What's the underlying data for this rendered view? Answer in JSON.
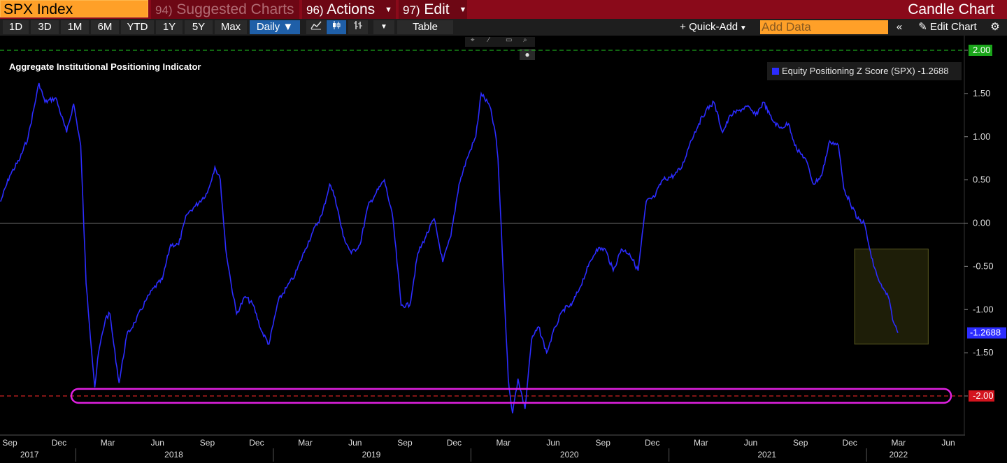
{
  "header": {
    "ticker": "SPX Index",
    "suggested": {
      "num": "94)",
      "label": "Suggested Charts"
    },
    "actions": {
      "num": "96)",
      "label": "Actions"
    },
    "edit": {
      "num": "97)",
      "label": "Edit"
    },
    "chart_type": "Candle Chart"
  },
  "toolbar": {
    "ranges": [
      "1D",
      "3D",
      "1M",
      "6M",
      "YTD",
      "1Y",
      "5Y",
      "Max"
    ],
    "interval": "Daily",
    "table_label": "Table",
    "quick_add": "Quick-Add",
    "add_data_placeholder": "Add Data",
    "edit_chart": "Edit Chart"
  },
  "colors": {
    "series": "#2c2cff",
    "upper_band": "#22cc22",
    "lower_band": "#ff2a2a",
    "highlight_ring": "#e020e0",
    "highlight_box": "#5a5a20"
  },
  "chart_data": {
    "type": "line",
    "title": "Aggregate Institutional Positioning Indicator",
    "series": [
      {
        "name": "Equity Positioning Z Score (SPX)",
        "last_value": "-1.2688",
        "points": [
          [
            "2017-08-15",
            0.25
          ],
          [
            "2017-09-01",
            0.55
          ],
          [
            "2017-09-20",
            0.75
          ],
          [
            "2017-10-05",
            1.0
          ],
          [
            "2017-10-25",
            1.62
          ],
          [
            "2017-11-05",
            1.4
          ],
          [
            "2017-11-25",
            1.45
          ],
          [
            "2017-12-15",
            1.05
          ],
          [
            "2017-12-28",
            1.38
          ],
          [
            "2018-01-10",
            0.9
          ],
          [
            "2018-01-20",
            -0.7
          ],
          [
            "2018-02-05",
            -1.9
          ],
          [
            "2018-02-12",
            -1.5
          ],
          [
            "2018-02-25",
            -1.1
          ],
          [
            "2018-03-05",
            -1.05
          ],
          [
            "2018-03-12",
            -1.4
          ],
          [
            "2018-03-22",
            -1.85
          ],
          [
            "2018-04-05",
            -1.3
          ],
          [
            "2018-04-20",
            -1.15
          ],
          [
            "2018-05-10",
            -0.9
          ],
          [
            "2018-05-25",
            -0.75
          ],
          [
            "2018-06-10",
            -0.65
          ],
          [
            "2018-06-25",
            -0.25
          ],
          [
            "2018-07-10",
            -0.25
          ],
          [
            "2018-07-25",
            0.1
          ],
          [
            "2018-08-10",
            0.2
          ],
          [
            "2018-09-01",
            0.35
          ],
          [
            "2018-09-15",
            0.65
          ],
          [
            "2018-09-25",
            0.5
          ],
          [
            "2018-10-05",
            -0.3
          ],
          [
            "2018-10-15",
            -0.7
          ],
          [
            "2018-10-25",
            -1.05
          ],
          [
            "2018-11-10",
            -0.85
          ],
          [
            "2018-11-25",
            -0.95
          ],
          [
            "2018-12-10",
            -1.25
          ],
          [
            "2018-12-24",
            -1.4
          ],
          [
            "2019-01-10",
            -0.9
          ],
          [
            "2019-01-25",
            -0.75
          ],
          [
            "2019-02-10",
            -0.6
          ],
          [
            "2019-03-01",
            -0.3
          ],
          [
            "2019-03-15",
            -0.1
          ],
          [
            "2019-04-01",
            0.1
          ],
          [
            "2019-04-15",
            0.45
          ],
          [
            "2019-04-25",
            0.3
          ],
          [
            "2019-05-10",
            -0.15
          ],
          [
            "2019-05-25",
            -0.35
          ],
          [
            "2019-06-10",
            -0.25
          ],
          [
            "2019-06-25",
            0.2
          ],
          [
            "2019-07-10",
            0.35
          ],
          [
            "2019-07-25",
            0.5
          ],
          [
            "2019-08-10",
            0.05
          ],
          [
            "2019-08-25",
            -0.95
          ],
          [
            "2019-09-10",
            -0.95
          ],
          [
            "2019-09-25",
            -0.35
          ],
          [
            "2019-10-10",
            -0.15
          ],
          [
            "2019-10-25",
            0.05
          ],
          [
            "2019-11-10",
            -0.45
          ],
          [
            "2019-11-25",
            -0.15
          ],
          [
            "2019-12-10",
            0.45
          ],
          [
            "2019-12-25",
            0.75
          ],
          [
            "2020-01-10",
            1.0
          ],
          [
            "2020-01-20",
            1.5
          ],
          [
            "2020-02-05",
            1.35
          ],
          [
            "2020-02-15",
            1.05
          ],
          [
            "2020-02-20",
            0.75
          ],
          [
            "2020-03-01",
            -0.6
          ],
          [
            "2020-03-10",
            -1.8
          ],
          [
            "2020-03-18",
            -2.2
          ],
          [
            "2020-03-28",
            -1.8
          ],
          [
            "2020-04-10",
            -2.15
          ],
          [
            "2020-04-22",
            -1.35
          ],
          [
            "2020-05-05",
            -1.2
          ],
          [
            "2020-05-20",
            -1.5
          ],
          [
            "2020-06-05",
            -1.2
          ],
          [
            "2020-06-20",
            -1.0
          ],
          [
            "2020-07-05",
            -0.95
          ],
          [
            "2020-07-20",
            -0.75
          ],
          [
            "2020-08-05",
            -0.5
          ],
          [
            "2020-08-20",
            -0.3
          ],
          [
            "2020-09-05",
            -0.3
          ],
          [
            "2020-09-20",
            -0.55
          ],
          [
            "2020-10-05",
            -0.3
          ],
          [
            "2020-10-20",
            -0.35
          ],
          [
            "2020-11-05",
            -0.55
          ],
          [
            "2020-11-20",
            0.25
          ],
          [
            "2020-12-05",
            0.3
          ],
          [
            "2020-12-20",
            0.5
          ],
          [
            "2021-01-10",
            0.55
          ],
          [
            "2021-01-25",
            0.65
          ],
          [
            "2021-02-10",
            0.95
          ],
          [
            "2021-02-25",
            1.15
          ],
          [
            "2021-03-10",
            1.3
          ],
          [
            "2021-03-25",
            1.4
          ],
          [
            "2021-04-10",
            1.05
          ],
          [
            "2021-04-25",
            1.25
          ],
          [
            "2021-05-10",
            1.3
          ],
          [
            "2021-05-25",
            1.35
          ],
          [
            "2021-06-10",
            1.25
          ],
          [
            "2021-06-25",
            1.4
          ],
          [
            "2021-07-10",
            1.2
          ],
          [
            "2021-07-25",
            1.1
          ],
          [
            "2021-08-10",
            1.15
          ],
          [
            "2021-08-25",
            0.85
          ],
          [
            "2021-09-10",
            0.75
          ],
          [
            "2021-09-25",
            0.45
          ],
          [
            "2021-10-10",
            0.55
          ],
          [
            "2021-10-25",
            0.95
          ],
          [
            "2021-11-10",
            0.9
          ],
          [
            "2021-11-20",
            0.4
          ],
          [
            "2021-12-01",
            0.25
          ],
          [
            "2021-12-15",
            0.05
          ],
          [
            "2021-12-28",
            0.0
          ],
          [
            "2022-01-10",
            -0.4
          ],
          [
            "2022-01-20",
            -0.6
          ],
          [
            "2022-01-30",
            -0.75
          ],
          [
            "2022-02-10",
            -0.85
          ],
          [
            "2022-02-20",
            -1.15
          ],
          [
            "2022-02-28",
            -1.27
          ]
        ]
      }
    ],
    "x_ticks_month": [
      "Sep",
      "Dec",
      "Mar",
      "Jun",
      "Sep",
      "Dec",
      "Mar",
      "Jun",
      "Sep",
      "Dec",
      "Mar",
      "Jun",
      "Sep",
      "Dec",
      "Mar",
      "Jun",
      "Sep",
      "Dec",
      "Mar",
      "Jun"
    ],
    "x_ticks_year": [
      "2017",
      "2018",
      "2019",
      "2020",
      "2021",
      "2022"
    ],
    "y_ticks": [
      "2.00",
      "1.50",
      "1.00",
      "0.50",
      "0.00",
      "-0.50",
      "-1.00",
      "-1.50",
      "-2.00"
    ],
    "ylim": [
      -2.4,
      2.0
    ],
    "reference_lines": [
      2.0,
      0.0,
      -2.0
    ]
  }
}
